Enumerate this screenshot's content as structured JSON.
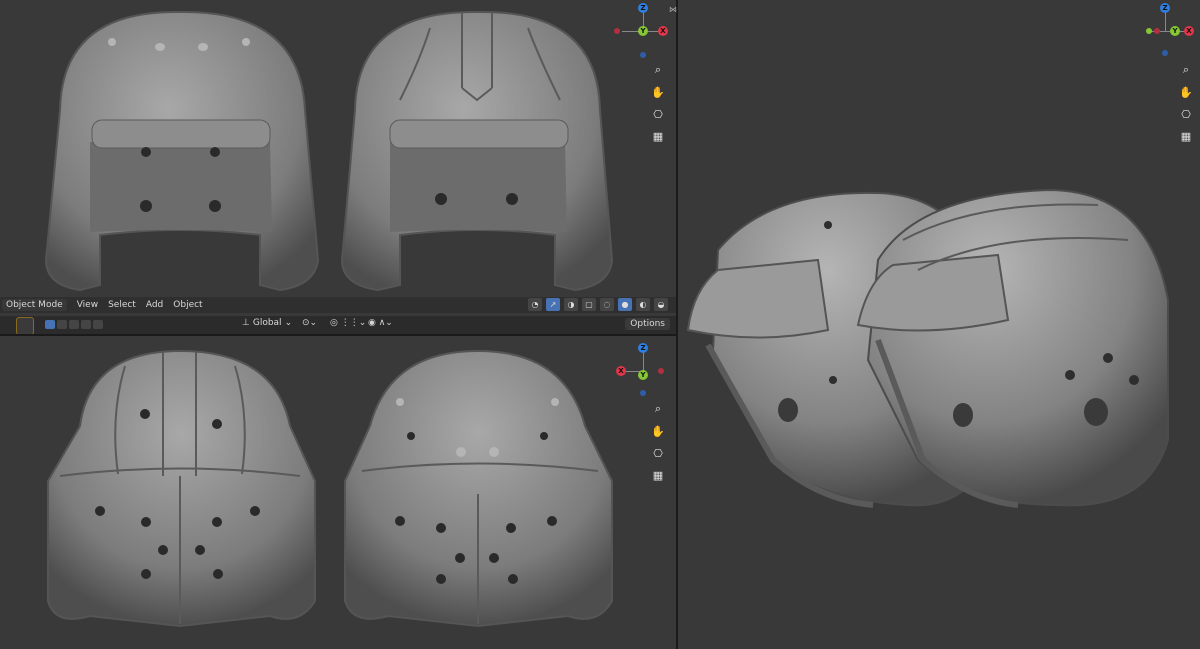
{
  "header": {
    "mode": "Object Mode",
    "menu": [
      "View",
      "Select",
      "Add",
      "Object"
    ],
    "orientation": "Global",
    "options": "Options"
  },
  "gizmo_labels": {
    "z": "Z",
    "y": "Y",
    "x": "X"
  },
  "nav_icons": [
    "zoom-icon",
    "pan-hand-icon",
    "camera-icon",
    "grid-icon"
  ],
  "colors": {
    "viewport": "#393939",
    "header": "#2f2f2f",
    "axis_x": "#e0364a",
    "axis_y": "#85c833",
    "axis_z": "#2f7ee0",
    "active": "#4772b3"
  }
}
